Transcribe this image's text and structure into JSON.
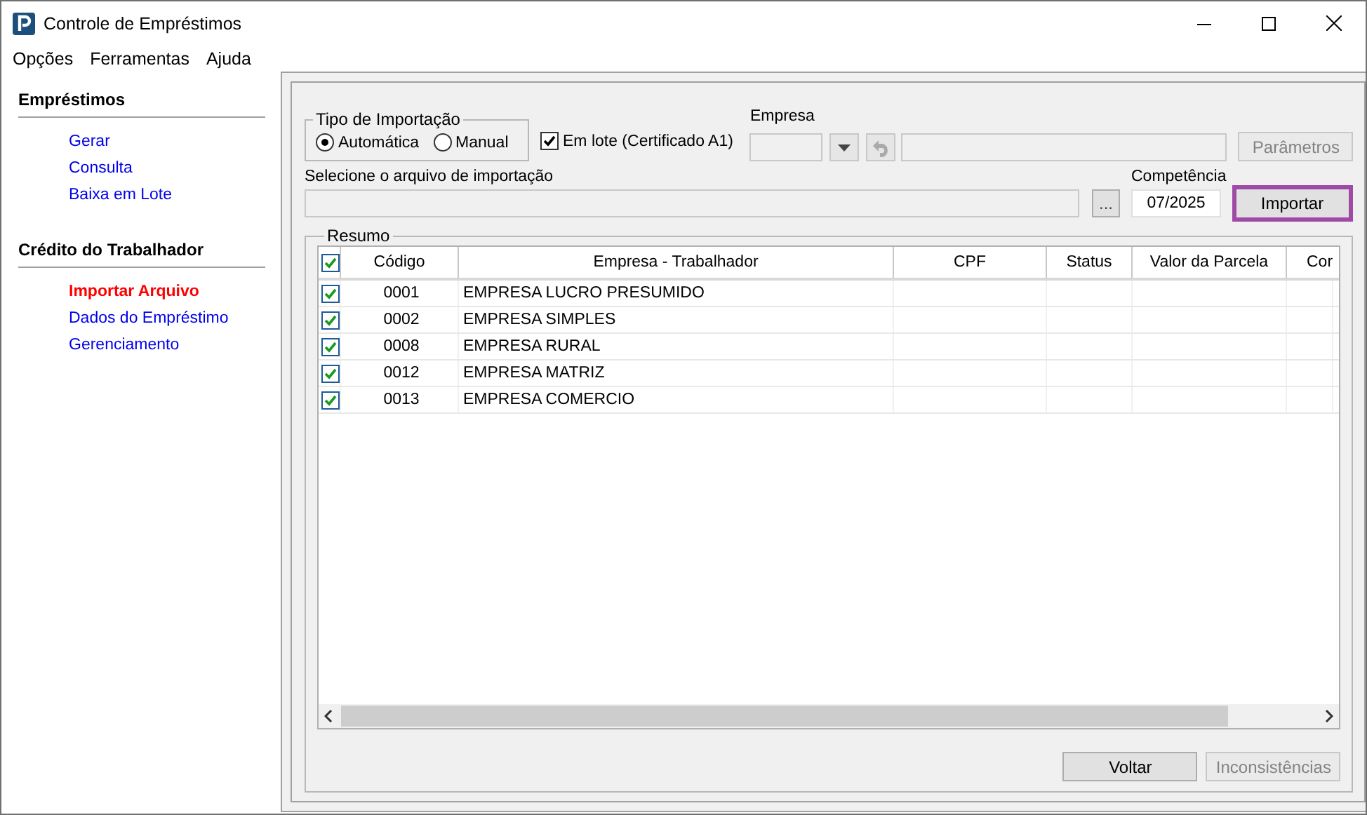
{
  "window": {
    "title": "Controle de Empréstimos"
  },
  "menu": [
    "Opções",
    "Ferramentas",
    "Ajuda"
  ],
  "sidebar": [
    {
      "title": "Empréstimos",
      "items": [
        {
          "label": "Gerar",
          "selected": false
        },
        {
          "label": "Consulta",
          "selected": false
        },
        {
          "label": "Baixa em Lote",
          "selected": false
        }
      ]
    },
    {
      "title": "Crédito do Trabalhador",
      "items": [
        {
          "label": "Importar Arquivo",
          "selected": true
        },
        {
          "label": "Dados do Empréstimo",
          "selected": false
        },
        {
          "label": "Gerenciamento",
          "selected": false
        }
      ]
    }
  ],
  "import_type": {
    "label": "Tipo de Importação",
    "options": [
      {
        "label": "Automática",
        "selected": true
      },
      {
        "label": "Manual",
        "selected": false
      }
    ]
  },
  "batch": {
    "label": "Em lote (Certificado A1)",
    "checked": true
  },
  "empresa": {
    "label": "Empresa",
    "disabled": true
  },
  "parameters_button": {
    "label": "Parâmetros",
    "disabled": true
  },
  "file": {
    "label": "Selecione o arquivo de importação",
    "browse": "..."
  },
  "competencia": {
    "label": "Competência",
    "value": "07/2025"
  },
  "import_button": {
    "label": "Importar",
    "highlighted": true
  },
  "summary": {
    "label": "Resumo",
    "all_checked": true,
    "columns": [
      "Código",
      "Empresa - Trabalhador",
      "CPF",
      "Status",
      "Valor da Parcela",
      "Cor"
    ],
    "rows": [
      {
        "checked": true,
        "code": "0001",
        "name": "EMPRESA LUCRO PRESUMIDO"
      },
      {
        "checked": true,
        "code": "0002",
        "name": "EMPRESA SIMPLES"
      },
      {
        "checked": true,
        "code": "0008",
        "name": "EMPRESA RURAL"
      },
      {
        "checked": true,
        "code": "0012",
        "name": "EMPRESA MATRIZ"
      },
      {
        "checked": true,
        "code": "0013",
        "name": "EMPRESA COMERCIO"
      }
    ]
  },
  "buttons": [
    {
      "label": "Voltar",
      "disabled": false
    },
    {
      "label": "Inconsistências",
      "disabled": true
    }
  ]
}
